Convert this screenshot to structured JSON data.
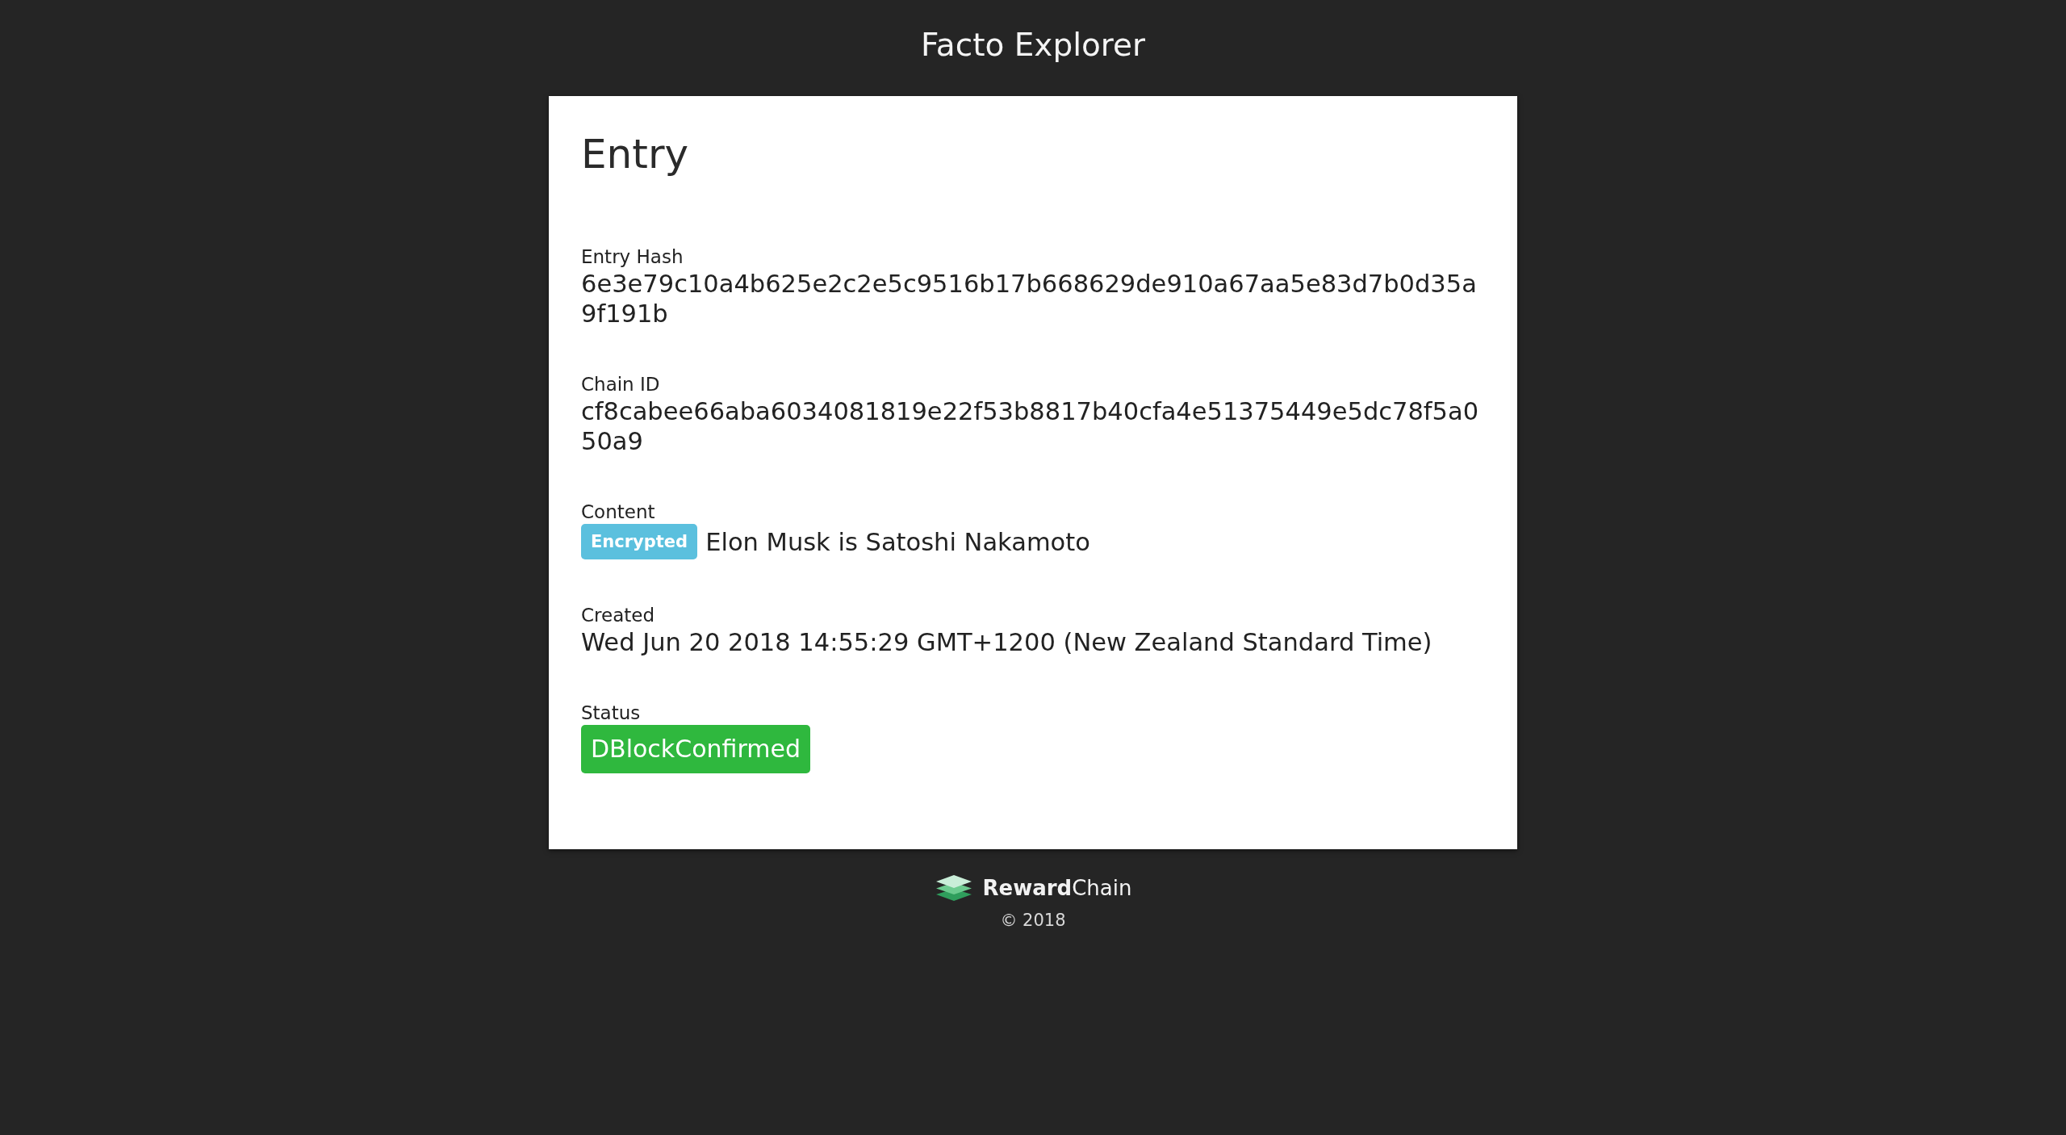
{
  "header": {
    "title": "Facto Explorer"
  },
  "entry": {
    "heading": "Entry",
    "fields": [
      {
        "kind": "text",
        "label": "Entry Hash",
        "value": "6e3e79c10a4b625e2c2e5c9516b17b668629de910a67aa5e83d7b0d35a9f191b"
      },
      {
        "kind": "text",
        "label": "Chain ID",
        "value": "cf8cabee66aba6034081819e22f53b8817b40cfa4e51375449e5dc78f5a050a9"
      },
      {
        "kind": "tagged_text",
        "label": "Content",
        "badge": {
          "text": "Encrypted",
          "color": "#5bc0de"
        },
        "value": "Elon Musk is Satoshi Nakamoto"
      },
      {
        "kind": "text",
        "label": "Created",
        "value": "Wed Jun 20 2018 14:55:29 GMT+1200 (New Zealand Standard Time)"
      },
      {
        "kind": "badge",
        "label": "Status",
        "badge": {
          "text": "DBlockConfirmed",
          "color": "#2fb83e"
        }
      }
    ]
  },
  "footer": {
    "brand": "**Reward**Chain",
    "copyright": "© 2018"
  }
}
